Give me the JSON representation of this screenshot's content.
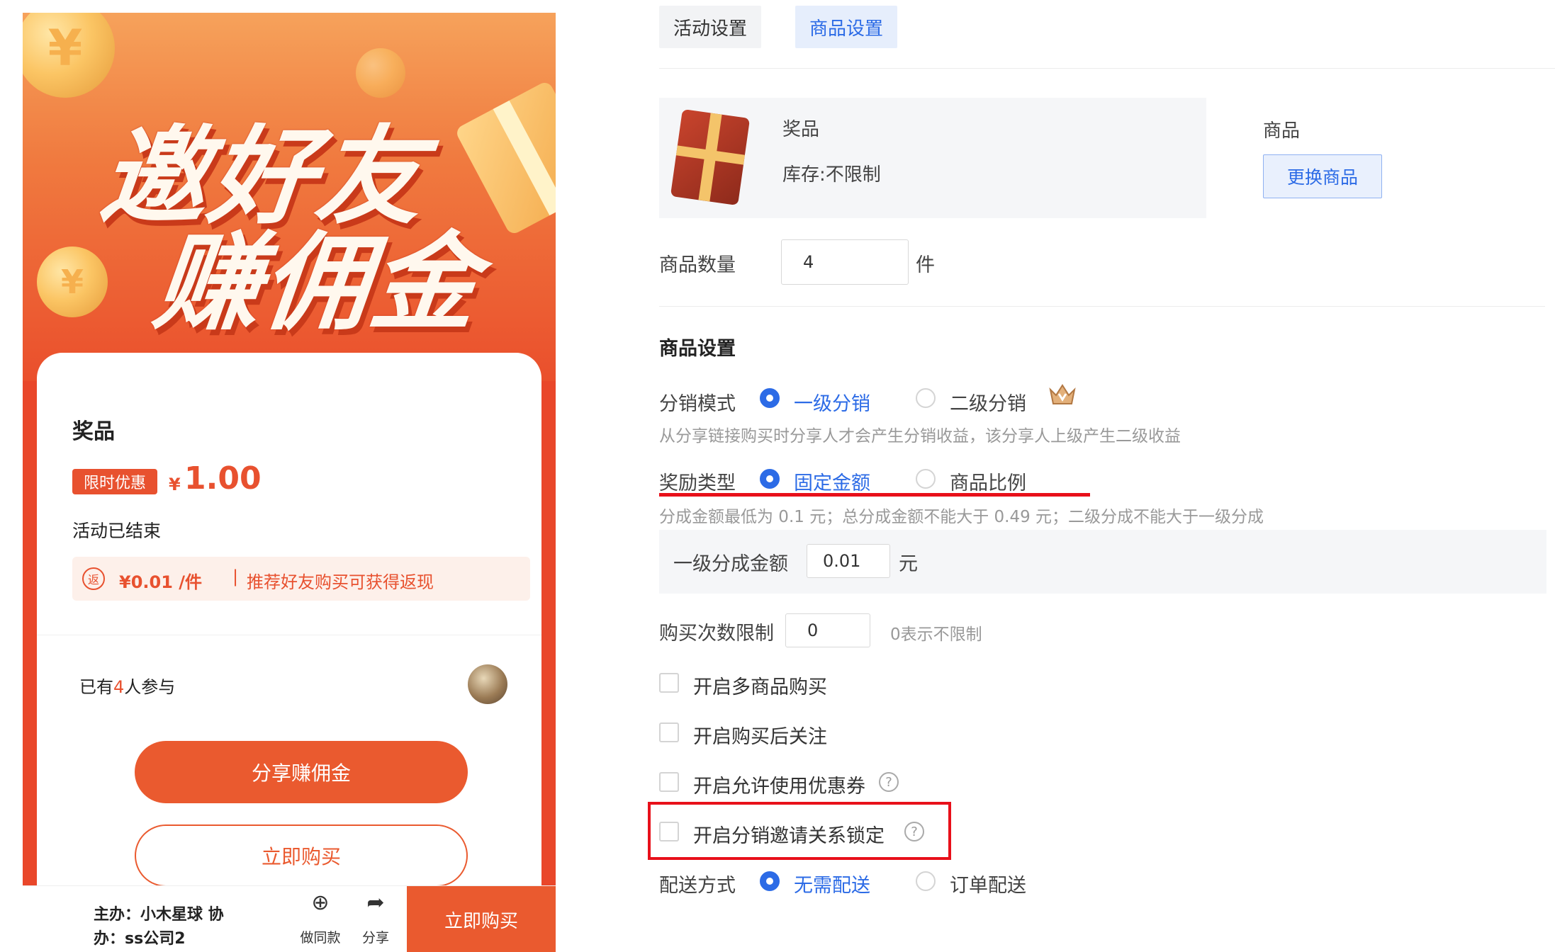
{
  "preview": {
    "banner_line1": "邀好友",
    "banner_line2": "赚佣金",
    "coin_glyph": "¥",
    "prize_label": "奖品",
    "limited_tag": "限时优惠",
    "price_symbol": "¥",
    "price": "1.00",
    "status": "活动已结束",
    "rebate_icon": "返",
    "rebate_amount": "¥0.01 /件",
    "rebate_sep": "|",
    "rebate_text": "推荐好友购买可获得返现",
    "joined_prefix": "已有",
    "joined_count": "4",
    "joined_suffix": "人参与",
    "share_button": "分享赚佣金",
    "buy_button": "立即购买",
    "footer": {
      "organizer_line1": "主办：小木星球 协",
      "organizer_line2": "办：ss公司2",
      "copy_icon": "⊕",
      "copy_label": "做同款",
      "share_icon": "➦",
      "share_label": "分享",
      "buy_label": "立即购买"
    }
  },
  "tabs": {
    "activity": "活动设置",
    "product": "商品设置"
  },
  "product_card": {
    "name": "奖品",
    "stock": "库存:不限制",
    "goods_label": "商品",
    "change_button": "更换商品"
  },
  "quantity": {
    "label": "商品数量",
    "value": "4",
    "unit": "件"
  },
  "settings": {
    "section_title": "商品设置",
    "distribution_mode": {
      "label": "分销模式",
      "option1": "一级分销",
      "option2": "二级分销",
      "hint": "从分享链接购买时分享人才会产生分销收益，该分享人上级产生二级收益"
    },
    "reward_type": {
      "label": "奖励类型",
      "option1": "固定金额",
      "option2": "商品比例",
      "hint": "分成金额最低为 0.1 元；总分成金额不能大于 0.49 元；二级分成不能大于一级分成"
    },
    "first_level": {
      "label": "一级分成金额",
      "value": "0.01",
      "unit": "元"
    },
    "purchase_limit": {
      "label": "购买次数限制",
      "value": "0",
      "hint": "0表示不限制"
    },
    "checkboxes": {
      "multi_product": "开启多商品购买",
      "follow_after_purchase": "开启购买后关注",
      "allow_coupons": "开启允许使用优惠券",
      "lock_relationship": "开启分销邀请关系锁定"
    },
    "delivery": {
      "label": "配送方式",
      "option1": "无需配送",
      "option2": "订单配送"
    },
    "help_glyph": "?"
  },
  "colors": {
    "accent_orange": "#ea5a2f",
    "accent_blue": "#2c6be6",
    "highlight_red": "#e8101a"
  }
}
